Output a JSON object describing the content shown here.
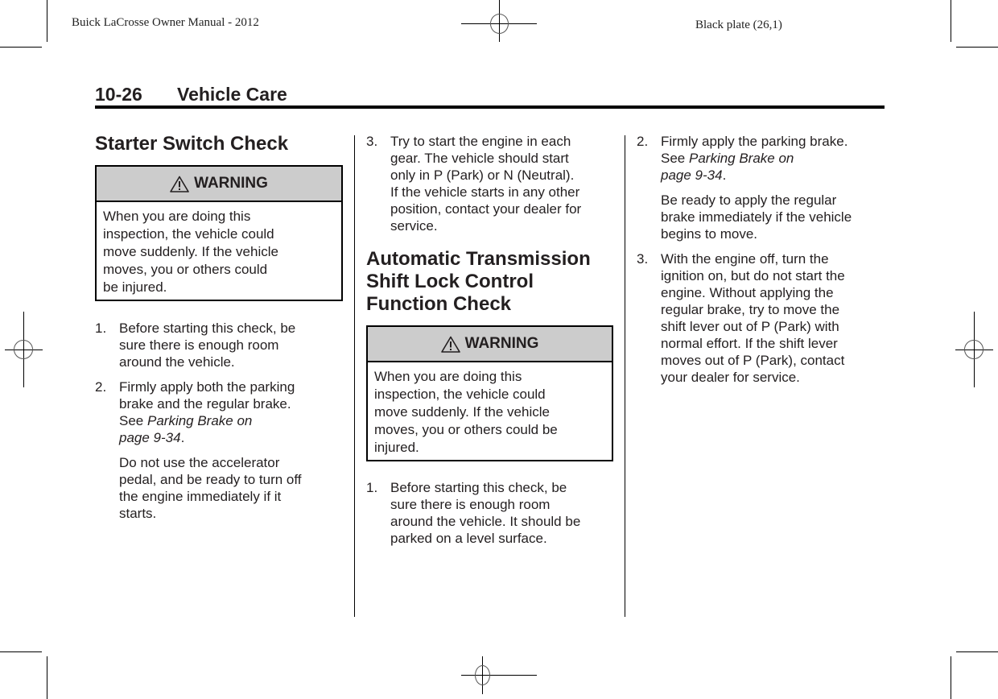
{
  "plate": {
    "left_label": "Buick LaCrosse Owner Manual - 2012",
    "right_label": "Black plate (26,1)"
  },
  "header": {
    "page_number": "10-26",
    "section_title": "Vehicle Care"
  },
  "col1": {
    "heading": "Starter Switch Check",
    "warning": {
      "icon": "warning-triangle-icon",
      "label": "WARNING",
      "lines": [
        "When you are doing this",
        "inspection, the vehicle could",
        "move suddenly. If the vehicle",
        "moves, you or others could",
        "be injured."
      ]
    },
    "steps": [
      {
        "number": "1.",
        "lines": [
          "Before starting this check, be",
          "sure there is enough room",
          "around the vehicle."
        ]
      },
      {
        "number": "2.",
        "lines": [
          "Firmly apply both the parking",
          "brake and the regular brake."
        ],
        "see": "See ",
        "ref_line1": "Parking Brake on",
        "ref_line2": "page 9-34",
        "ref_end": ".",
        "extra_lines": [
          "Do not use the accelerator",
          "pedal, and be ready to turn off",
          "the engine immediately if it",
          "starts."
        ]
      }
    ]
  },
  "col2": {
    "steps": [
      {
        "number": "3.",
        "lines": [
          "Try to start the engine in each",
          "gear. The vehicle should start",
          "only in P (Park) or N (Neutral).",
          "If the vehicle starts in any other",
          "position, contact your dealer for",
          "service."
        ]
      }
    ],
    "heading_lines": [
      "Automatic Transmission",
      "Shift Lock Control",
      "Function Check"
    ],
    "warning": {
      "icon": "warning-triangle-icon",
      "label": "WARNING",
      "lines": [
        "When you are doing this",
        "inspection, the vehicle could",
        "move suddenly. If the vehicle",
        "moves, you or others could be",
        "injured."
      ]
    },
    "steps2": [
      {
        "number": "1.",
        "lines": [
          "Before starting this check, be",
          "sure there is enough room",
          "around the vehicle. It should be",
          "parked on a level surface."
        ]
      }
    ]
  },
  "col3": {
    "steps": [
      {
        "number": "2.",
        "lines": [
          "Firmly apply the parking brake."
        ],
        "see": "See ",
        "ref_line1": "Parking Brake on",
        "ref_line2": "page 9-34",
        "ref_end": ".",
        "extra_lines": [
          "Be ready to apply the regular",
          "brake immediately if the vehicle",
          "begins to move."
        ]
      },
      {
        "number": "3.",
        "lines": [
          "With the engine off, turn the",
          "ignition on, but do not start the",
          "engine. Without applying the",
          "regular brake, try to move the",
          "shift lever out of P (Park) with",
          "normal effort. If the shift lever",
          "moves out of P (Park), contact",
          "your dealer for service."
        ]
      }
    ]
  }
}
